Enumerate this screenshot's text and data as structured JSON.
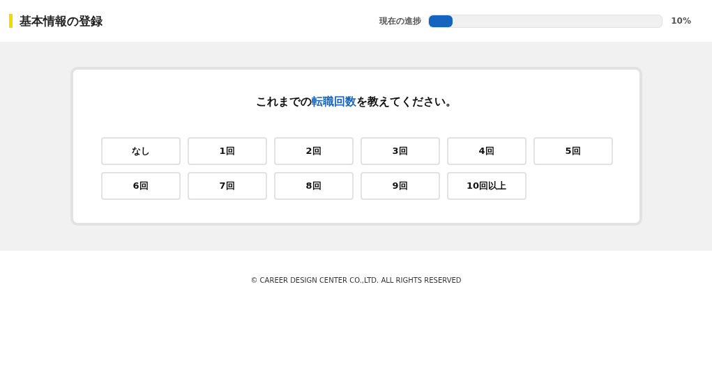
{
  "header": {
    "title": "基本情報の登録",
    "progress_label": "現在の進捗",
    "level": 0.1,
    "progress_text": "10%"
  },
  "question": {
    "before": "これまでの",
    "highlight": "転職回数",
    "after": "を教えてください。"
  },
  "options": [
    {
      "label": "なし",
      "selected": false
    },
    {
      "label": "1回",
      "selected": false
    },
    {
      "label": "2回",
      "selected": false
    },
    {
      "label": "3回",
      "selected": false
    },
    {
      "label": "4回",
      "selected": false
    },
    {
      "label": "5回",
      "selected": false
    },
    {
      "label": "6回",
      "selected": false
    },
    {
      "label": "7回",
      "selected": false
    },
    {
      "label": "8回",
      "selected": false
    },
    {
      "label": "9回",
      "selected": false
    },
    {
      "label": "10回以上",
      "selected": false
    }
  ],
  "footer": "© CAREER DESIGN CENTER CO.,LTD. ALL RIGHTS RESERVED"
}
